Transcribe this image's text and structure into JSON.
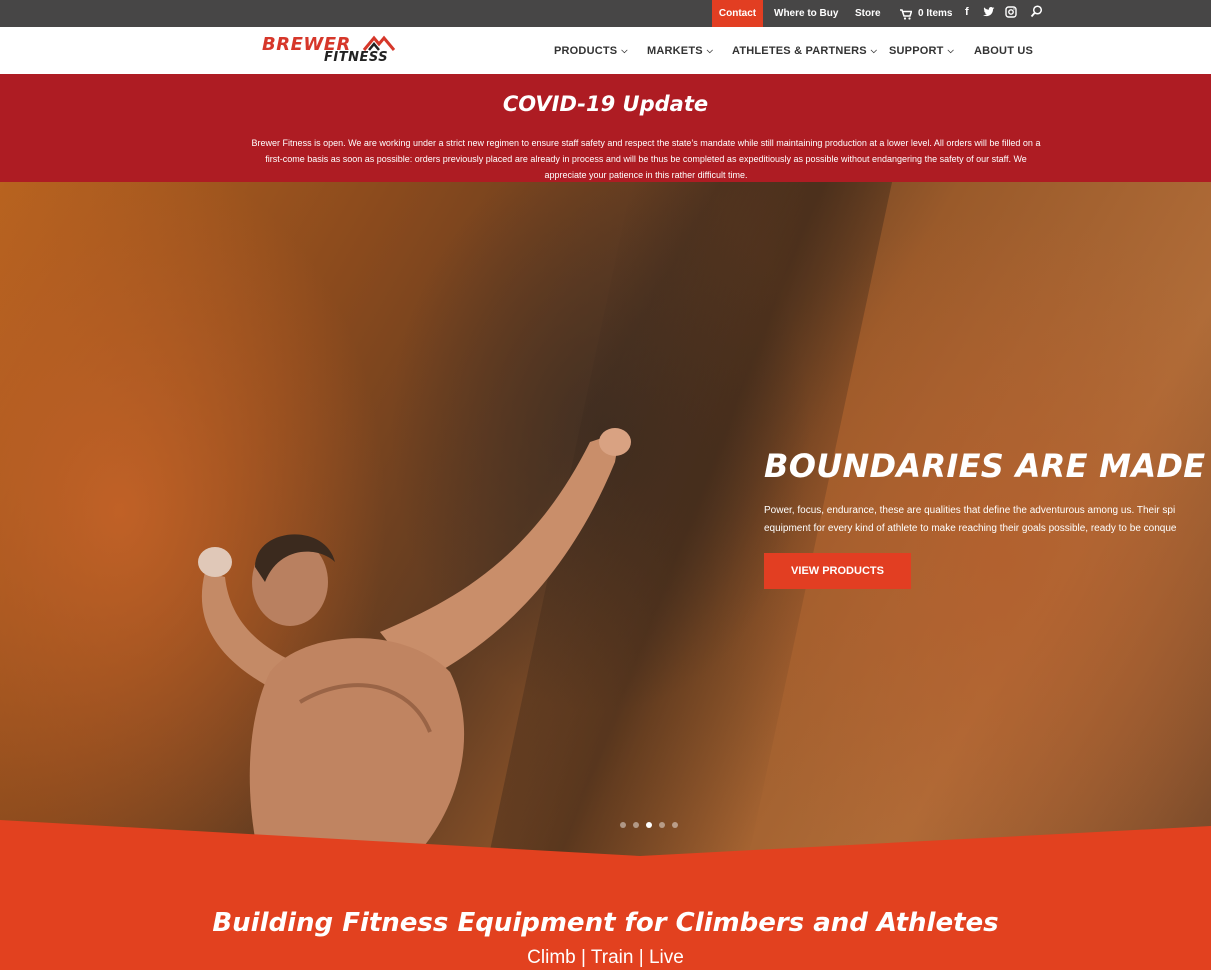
{
  "topbar": {
    "contact_label": "Contact",
    "where_to_buy_label": "Where to Buy",
    "store_label": "Store",
    "cart_label": "0 Items",
    "social": [
      "facebook-icon",
      "twitter-icon",
      "instagram-icon"
    ],
    "search_icon": "search-icon"
  },
  "header": {
    "logo_line1": "BREWER",
    "logo_line2": "FITNESS",
    "nav": [
      {
        "label": "PRODUCTS",
        "dropdown": true
      },
      {
        "label": "MARKETS",
        "dropdown": true
      },
      {
        "label": "ATHLETES & PARTNERS",
        "dropdown": true
      },
      {
        "label": "SUPPORT",
        "dropdown": true
      },
      {
        "label": "ABOUT US",
        "dropdown": false
      }
    ]
  },
  "covid": {
    "title": "COVID-19 Update",
    "body": "Brewer Fitness is open.  We are working under a strict new regimen to ensure staff safety and respect the state’s mandate while still maintaining production at a lower level.  All orders will be filled on a first-come basis as soon as possible: orders previously placed are already in process and will be thus be completed as expeditiously as possible without endangering the safety of our staff. We appreciate your patience in this rather difficult time."
  },
  "hero": {
    "headline": "BOUNDARIES ARE MADE TO",
    "subtext_line1": "Power, focus, endurance, these are qualities that define the adventurous among us. Their spi",
    "subtext_line2": "equipment for every kind of athlete to make reaching their goals possible, ready to be conque",
    "button_label": "VIEW PRODUCTS",
    "slides_count": 5,
    "active_slide": 3
  },
  "section": {
    "title": "Building Fitness Equipment for Climbers and Athletes",
    "tagline": "Climb | Train | Live"
  },
  "colors": {
    "accent": "#e23e22",
    "covid_bg": "#ae1c23",
    "topbar_bg": "#474646",
    "section_bg": "#e2411f"
  }
}
